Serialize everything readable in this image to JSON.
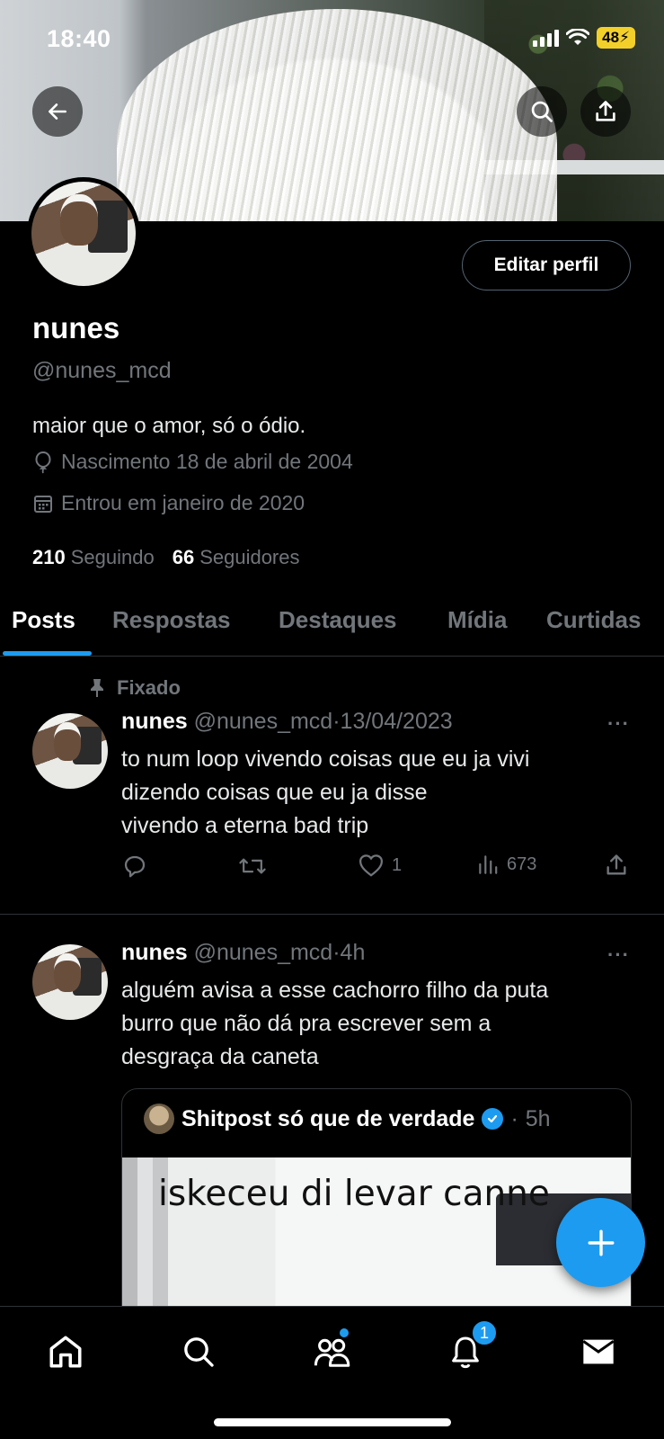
{
  "status_bar": {
    "time": "18:40",
    "battery": "48"
  },
  "profile": {
    "edit_button": "Editar perfil",
    "name": "nunes",
    "handle": "@nunes_mcd",
    "bio": "maior que o amor, só o ódio.",
    "birth": "Nascimento 18 de abril de 2004",
    "joined": "Entrou em janeiro de 2020",
    "following_count": "210",
    "following_label": "Seguindo",
    "followers_count": "66",
    "followers_label": "Seguidores"
  },
  "tabs": [
    {
      "label": "Posts",
      "active": true
    },
    {
      "label": "Respostas",
      "active": false
    },
    {
      "label": "Destaques",
      "active": false
    },
    {
      "label": "Mídia",
      "active": false
    },
    {
      "label": "Curtidas",
      "active": false
    }
  ],
  "tweets": [
    {
      "pinned_label": "Fixado",
      "name": "nunes",
      "handle": "@nunes_mcd",
      "sep": "·",
      "time": "13/04/2023",
      "more": "···",
      "text": "to num loop vivendo coisas que eu ja vivi\ndizendo coisas que eu ja disse\nvivendo a eterna bad trip",
      "likes": "1",
      "views": "673"
    },
    {
      "name": "nunes",
      "handle": "@nunes_mcd",
      "sep": "·",
      "time": "4h",
      "more": "···",
      "text": "alguém avisa a esse cachorro filho da puta\nburro que não dá pra escrever sem a\ndesgraça da caneta",
      "quote": {
        "name": "Shitpost só que de verdade",
        "sep": "·",
        "time": "5h",
        "media_text": "iskeceu di levar canne"
      }
    }
  ],
  "bottom_nav": {
    "notifications_badge": "1"
  },
  "colors": {
    "accent": "#1d9bf0",
    "background": "#000000",
    "muted": "#71767b",
    "border": "#2f3336"
  }
}
